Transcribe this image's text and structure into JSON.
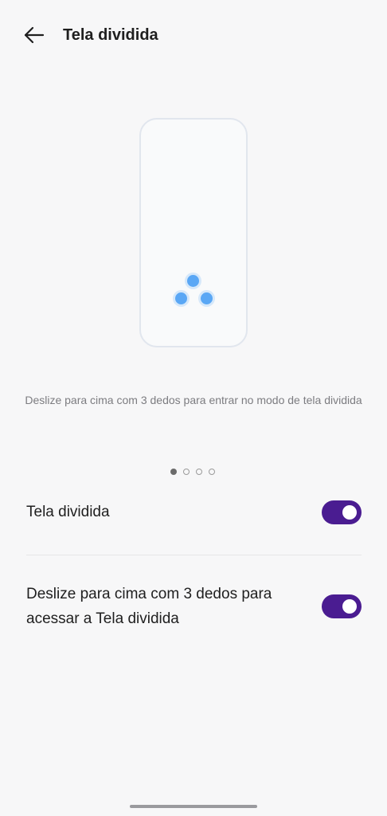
{
  "header": {
    "title": "Tela dividida",
    "back_icon": "arrow-left-icon"
  },
  "illustration": {
    "icon": "three-finger-swipe-icon",
    "dot_color": "#5aa7f5"
  },
  "hint": {
    "text": "Deslize para cima com 3 dedos para entrar no modo de tela dividida"
  },
  "pager": {
    "total": 4,
    "active_index": 0
  },
  "settings": [
    {
      "label": "Tela dividida",
      "enabled": true
    },
    {
      "label": "Deslize para cima com 3 dedos para acessar a Tela dividida",
      "enabled": true
    }
  ],
  "colors": {
    "accent": "#4a1c91",
    "background": "#f7f7f8"
  }
}
